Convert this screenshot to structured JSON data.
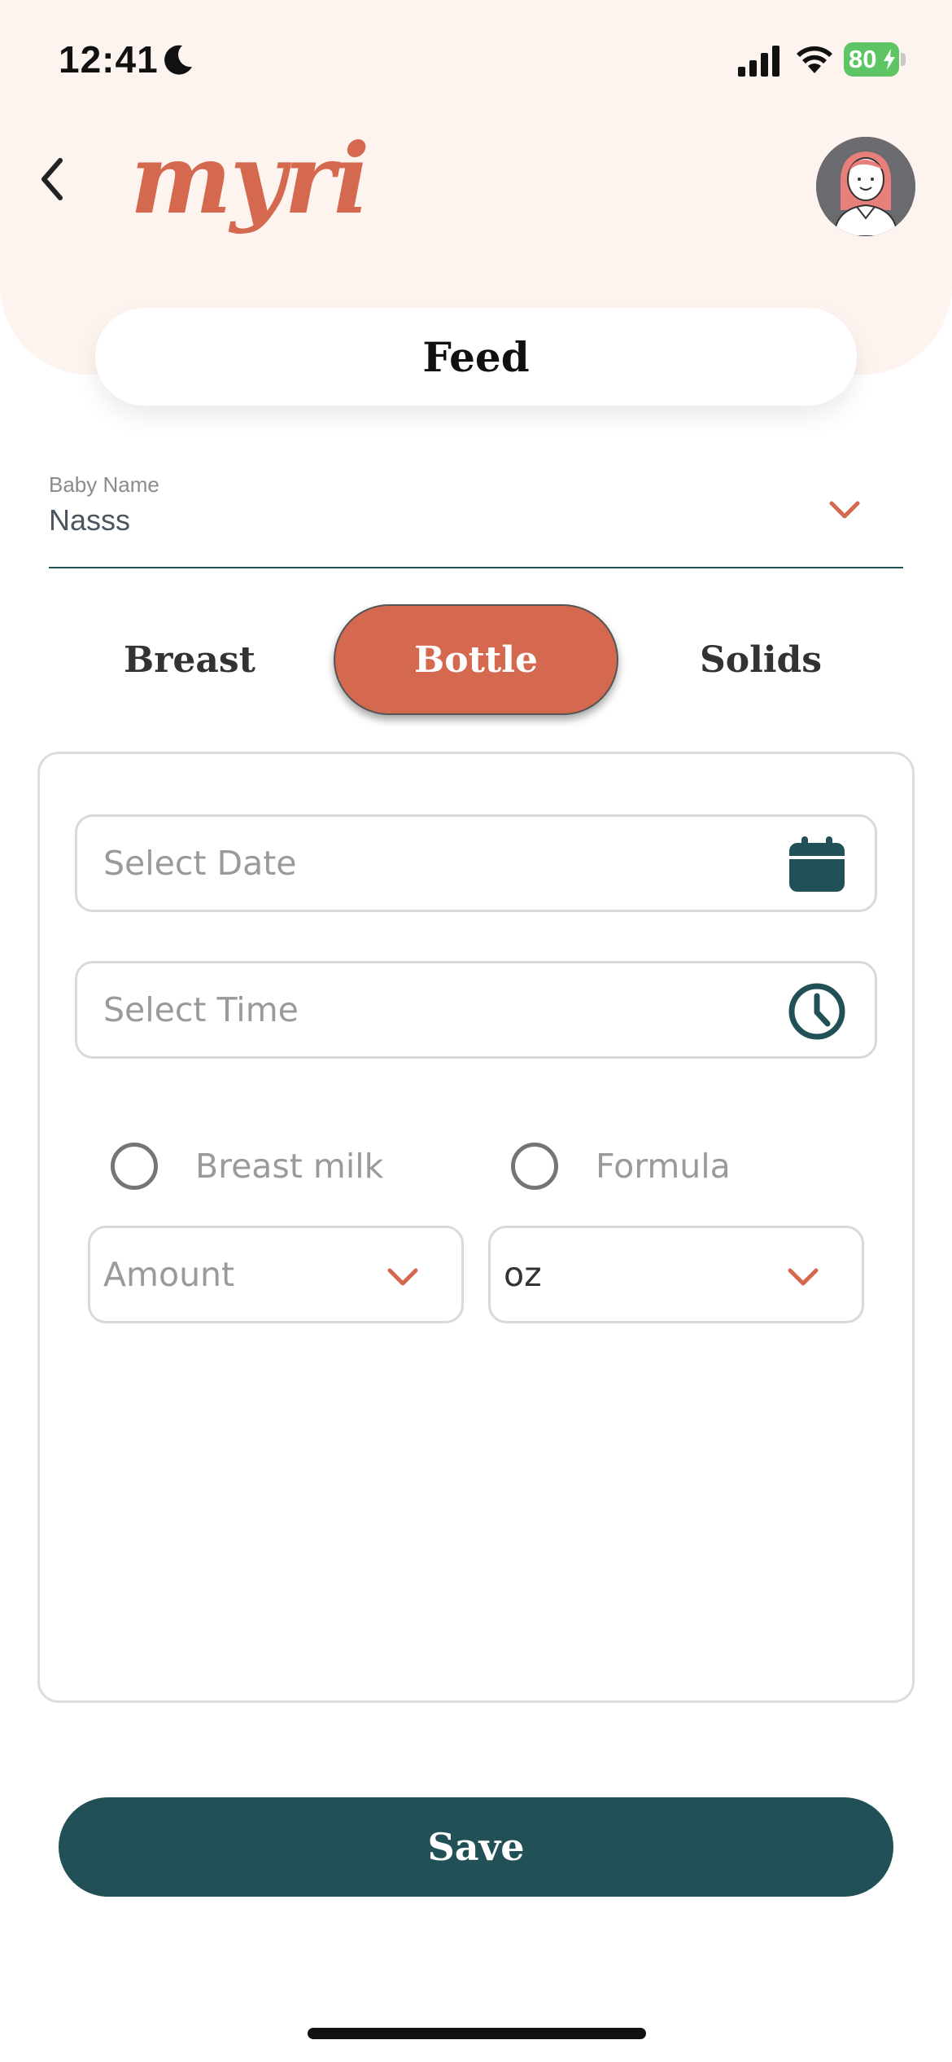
{
  "status_bar": {
    "time": "12:41",
    "battery": "80",
    "icons": [
      "moon-icon",
      "signal-icon",
      "wifi-icon",
      "battery-icon",
      "bolt-icon"
    ]
  },
  "header": {
    "logo": "myri",
    "title": "Feed",
    "icons": [
      "chevron-left-icon",
      "avatar"
    ]
  },
  "baby_name": {
    "label": "Baby Name",
    "value": "Nasss"
  },
  "feed_tabs": {
    "items": [
      {
        "label": "Breast",
        "selected": false
      },
      {
        "label": "Bottle",
        "selected": true
      },
      {
        "label": "Solids",
        "selected": false
      }
    ]
  },
  "form": {
    "date_placeholder": "Select Date",
    "time_placeholder": "Select Time",
    "milk_type_options": [
      {
        "label": "Breast milk",
        "checked": false
      },
      {
        "label": "Formula",
        "checked": false
      }
    ],
    "amount_placeholder": "Amount",
    "unit_value": "oz"
  },
  "actions": {
    "save_label": "Save"
  },
  "colors": {
    "accent": "#d4694f",
    "primary": "#215157",
    "header_bg": "#fdf3ef",
    "battery": "#5dc563"
  }
}
